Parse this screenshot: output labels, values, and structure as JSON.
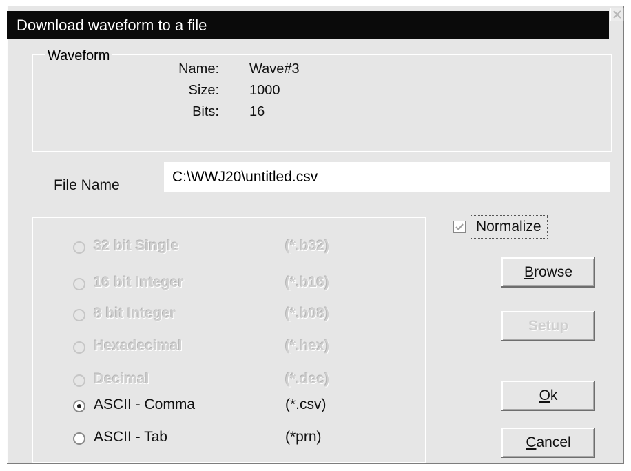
{
  "dialog": {
    "title": "Download waveform to a file"
  },
  "waveform": {
    "legend": "Waveform",
    "name_label": "Name:",
    "name_value": "Wave#3",
    "size_label": "Size:",
    "size_value": "1000",
    "bits_label": "Bits:",
    "bits_value": "16"
  },
  "file": {
    "label": "File Name",
    "value": "C:\\WWJ20\\untitled.csv"
  },
  "formats": [
    {
      "label": "32 bit Single",
      "ext": "(*.b32)",
      "enabled": false,
      "checked": false
    },
    {
      "label": "16 bit Integer",
      "ext": "(*.b16)",
      "enabled": false,
      "checked": false
    },
    {
      "label": "8 bit Integer",
      "ext": "(*.b08)",
      "enabled": false,
      "checked": false
    },
    {
      "label": "Hexadecimal",
      "ext": "(*.hex)",
      "enabled": false,
      "checked": false
    },
    {
      "label": "Decimal",
      "ext": "(*.dec)",
      "enabled": false,
      "checked": false
    },
    {
      "label": "ASCII - Comma",
      "ext": "(*.csv)",
      "enabled": true,
      "checked": true
    },
    {
      "label": "ASCII - Tab",
      "ext": "(*prn)",
      "enabled": true,
      "checked": false
    }
  ],
  "normalize": {
    "label": "Normalize",
    "checked": true
  },
  "buttons": {
    "browse_first": "B",
    "browse_rest": "rowse",
    "setup": "Setup",
    "ok_first": "O",
    "ok_rest": "k",
    "cancel_first": "C",
    "cancel_rest": "ancel"
  }
}
